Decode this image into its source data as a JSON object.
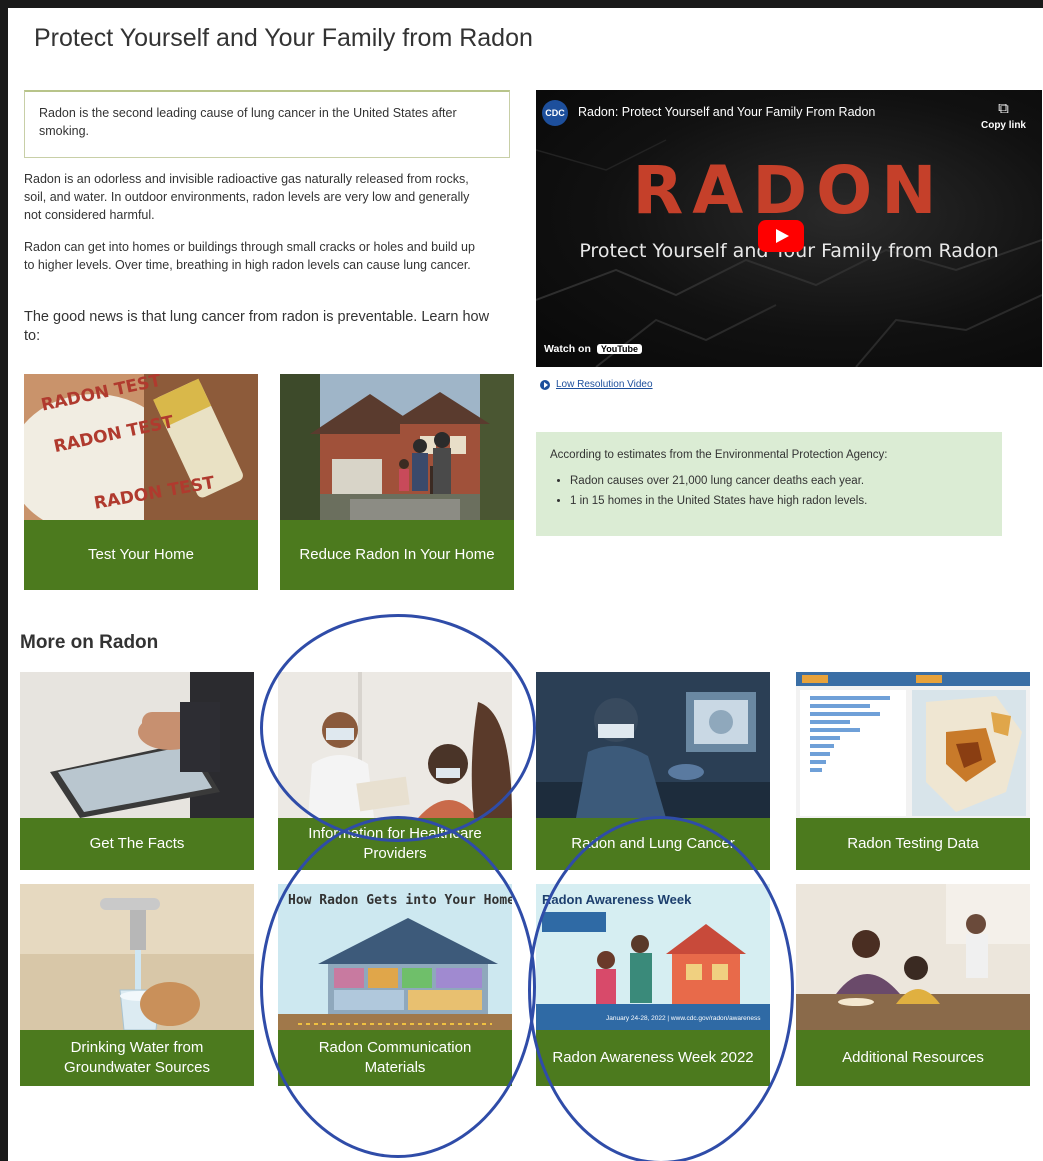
{
  "page": {
    "title": "Protect Yourself and Your Family from Radon"
  },
  "intro": {
    "callout": "Radon is the second leading cause of lung cancer in the United States after smoking.",
    "paragraph1": "Radon is an odorless and invisible radioactive gas naturally released from rocks, soil, and water. In outdoor environments, radon levels are very low and generally not considered harmful.",
    "paragraph2": "Radon can get into homes or buildings through small cracks or holes and build up to higher levels. Over time, breathing in high radon levels can cause lung cancer.",
    "paragraph3": "The good news is that lung cancer from radon is preventable. Learn how to:"
  },
  "video": {
    "channel_logo": "CDC",
    "title": "Radon: Protect Yourself and Your Family From Radon",
    "copy_link": "Copy link",
    "big_title": "RADON",
    "subtitle": "Protect Yourself and Your Family from Radon",
    "watch_on": "Watch on",
    "youtube": "YouTube",
    "low_res_link": "Low Resolution Video"
  },
  "epa": {
    "intro": "According to estimates from the Environmental Protection Agency:",
    "bullets": [
      "Radon causes over 21,000 lung cancer deaths each year.",
      "1 in 15 homes in the United States have high radon levels."
    ]
  },
  "primary_cards": [
    {
      "label": "Test Your Home",
      "image_text_1": "RADON TEST",
      "image_text_2": "RADON TEST"
    },
    {
      "label": "Reduce Radon In Your Home"
    }
  ],
  "more": {
    "heading": "More on Radon",
    "cards": [
      {
        "label": "Get The Facts"
      },
      {
        "label": "Information for Healthcare Providers"
      },
      {
        "label": "Radon and Lung Cancer"
      },
      {
        "label": "Radon Testing Data"
      },
      {
        "label": "Drinking Water from Groundwater Sources"
      },
      {
        "label": "Radon Communication Materials",
        "image_title": "How Radon Gets into Your Home"
      },
      {
        "label": "Radon Awareness Week 2022",
        "image_title": "Radon Awareness Week",
        "image_footer": "January 24-28, 2022  |  www.cdc.gov/radon/awareness"
      },
      {
        "label": "Additional Resources"
      }
    ]
  },
  "colors": {
    "card_green": "#4c7a1e",
    "annotation_blue": "#2f4ca8",
    "epa_bg": "#dbecd4",
    "link_blue": "#1d4f9c"
  }
}
